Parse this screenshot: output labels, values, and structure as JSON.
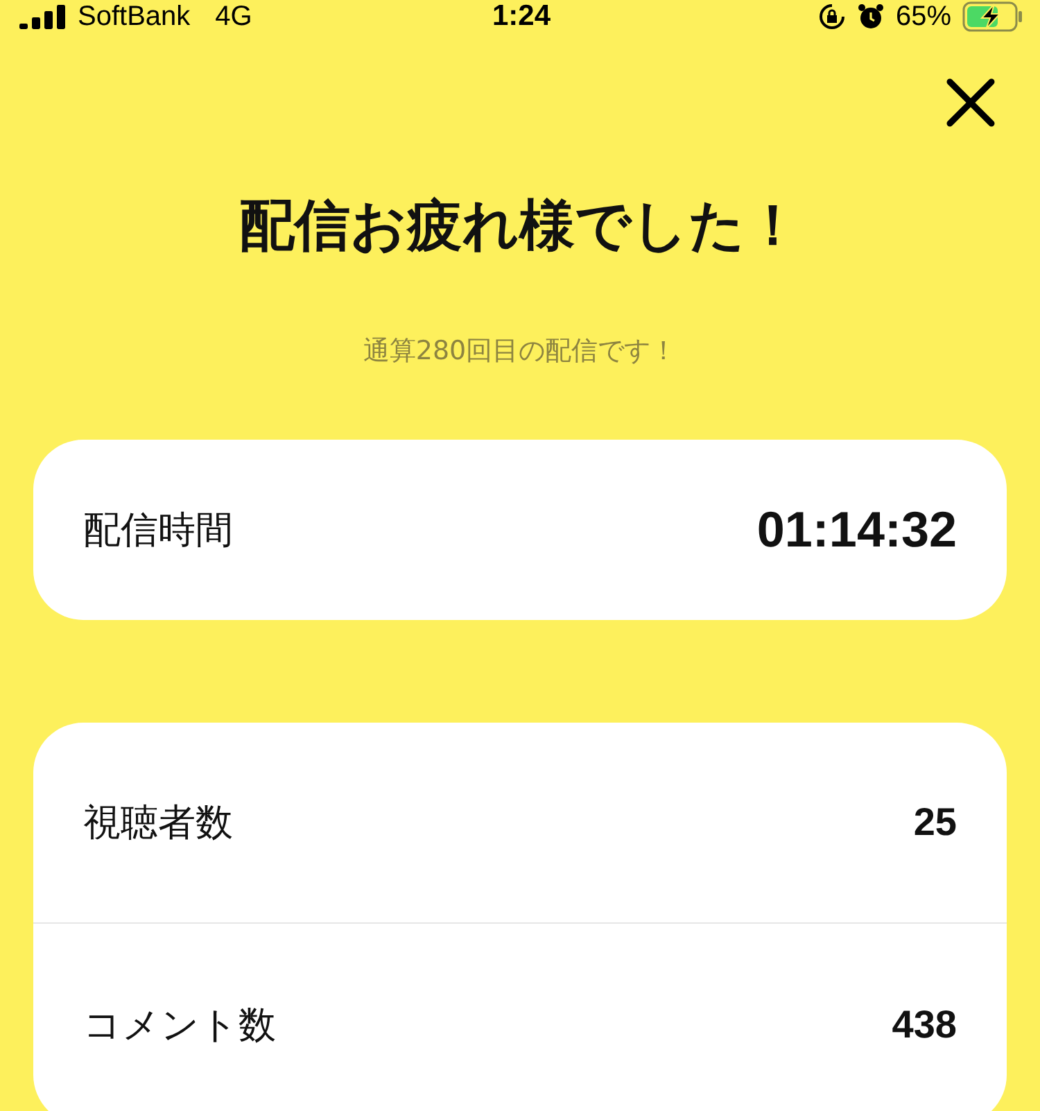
{
  "status_bar": {
    "carrier": "SoftBank",
    "network": "4G",
    "time": "1:24",
    "battery_percent": "65%",
    "charging": true
  },
  "title": "配信お疲れ様でした！",
  "subtitle": "通算280回目の配信です！",
  "duration": {
    "label": "配信時間",
    "value": "01:14:32"
  },
  "stats": [
    {
      "label": "視聴者数",
      "value": "25"
    },
    {
      "label": "コメント数",
      "value": "438"
    }
  ]
}
